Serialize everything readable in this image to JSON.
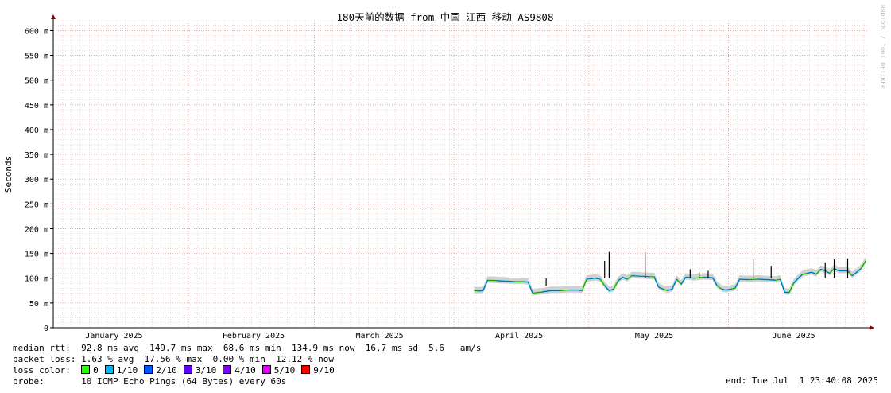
{
  "watermark": "RRDTOOL / TOBI OETIKER",
  "chart_data": {
    "type": "line",
    "title": "180天前的数据 from 中国 江西 移动 AS9808",
    "ylabel": "Seconds",
    "xlabel": "",
    "ylim": [
      0,
      0.62
    ],
    "y_ticks": [
      {
        "v": 0,
        "label": "0"
      },
      {
        "v": 0.05,
        "label": "50 m"
      },
      {
        "v": 0.1,
        "label": "100 m"
      },
      {
        "v": 0.15,
        "label": "150 m"
      },
      {
        "v": 0.2,
        "label": "200 m"
      },
      {
        "v": 0.25,
        "label": "250 m"
      },
      {
        "v": 0.3,
        "label": "300 m"
      },
      {
        "v": 0.35,
        "label": "350 m"
      },
      {
        "v": 0.4,
        "label": "400 m"
      },
      {
        "v": 0.45,
        "label": "450 m"
      },
      {
        "v": 0.5,
        "label": "500 m"
      },
      {
        "v": 0.55,
        "label": "550 m"
      },
      {
        "v": 0.6,
        "label": "600 m"
      }
    ],
    "x_labels": [
      {
        "label": "January 2025",
        "date": "2025-01-15"
      },
      {
        "label": "February 2025",
        "date": "2025-02-15"
      },
      {
        "label": "March 2025",
        "date": "2025-03-15"
      },
      {
        "label": "April 2025",
        "date": "2025-04-15"
      },
      {
        "label": "May 2025",
        "date": "2025-05-15"
      },
      {
        "label": "June 2025",
        "date": "2025-06-15"
      }
    ],
    "x_range": [
      "2025-01-02",
      "2025-07-01"
    ],
    "grid": true,
    "series": [
      {
        "name": "median rtt",
        "points": [
          [
            "2025-04-05",
            0.075
          ],
          [
            "2025-04-06",
            0.074
          ],
          [
            "2025-04-07",
            0.075
          ],
          [
            "2025-04-08",
            0.096
          ],
          [
            "2025-04-10",
            0.095
          ],
          [
            "2025-04-12",
            0.094
          ],
          [
            "2025-04-14",
            0.093
          ],
          [
            "2025-04-16",
            0.093
          ],
          [
            "2025-04-17",
            0.092
          ],
          [
            "2025-04-18",
            0.07
          ],
          [
            "2025-04-20",
            0.072
          ],
          [
            "2025-04-22",
            0.075
          ],
          [
            "2025-04-24",
            0.075
          ],
          [
            "2025-04-26",
            0.076
          ],
          [
            "2025-04-28",
            0.076
          ],
          [
            "2025-04-29",
            0.075
          ],
          [
            "2025-04-30",
            0.098
          ],
          [
            "2025-05-02",
            0.1
          ],
          [
            "2025-05-03",
            0.098
          ],
          [
            "2025-05-04",
            0.085
          ],
          [
            "2025-05-05",
            0.075
          ],
          [
            "2025-05-06",
            0.078
          ],
          [
            "2025-05-07",
            0.095
          ],
          [
            "2025-05-08",
            0.102
          ],
          [
            "2025-05-09",
            0.098
          ],
          [
            "2025-05-10",
            0.105
          ],
          [
            "2025-05-12",
            0.104
          ],
          [
            "2025-05-14",
            0.103
          ],
          [
            "2025-05-15",
            0.103
          ],
          [
            "2025-05-16",
            0.082
          ],
          [
            "2025-05-17",
            0.078
          ],
          [
            "2025-05-18",
            0.075
          ],
          [
            "2025-05-19",
            0.078
          ],
          [
            "2025-05-20",
            0.098
          ],
          [
            "2025-05-21",
            0.088
          ],
          [
            "2025-05-22",
            0.102
          ],
          [
            "2025-05-24",
            0.1
          ],
          [
            "2025-05-26",
            0.102
          ],
          [
            "2025-05-28",
            0.101
          ],
          [
            "2025-05-29",
            0.085
          ],
          [
            "2025-05-30",
            0.078
          ],
          [
            "2025-05-31",
            0.076
          ],
          [
            "2025-06-01",
            0.078
          ],
          [
            "2025-06-02",
            0.08
          ],
          [
            "2025-06-03",
            0.098
          ],
          [
            "2025-06-05",
            0.097
          ],
          [
            "2025-06-07",
            0.098
          ],
          [
            "2025-06-09",
            0.097
          ],
          [
            "2025-06-11",
            0.096
          ],
          [
            "2025-06-12",
            0.098
          ],
          [
            "2025-06-13",
            0.072
          ],
          [
            "2025-06-14",
            0.071
          ],
          [
            "2025-06-15",
            0.09
          ],
          [
            "2025-06-16",
            0.1
          ],
          [
            "2025-06-17",
            0.108
          ],
          [
            "2025-06-18",
            0.11
          ],
          [
            "2025-06-19",
            0.112
          ],
          [
            "2025-06-20",
            0.108
          ],
          [
            "2025-06-21",
            0.118
          ],
          [
            "2025-06-22",
            0.115
          ],
          [
            "2025-06-23",
            0.11
          ],
          [
            "2025-06-24",
            0.12
          ],
          [
            "2025-06-25",
            0.115
          ],
          [
            "2025-06-27",
            0.115
          ],
          [
            "2025-06-28",
            0.105
          ],
          [
            "2025-06-29",
            0.112
          ],
          [
            "2025-06-30",
            0.12
          ],
          [
            "2025-07-01",
            0.135
          ]
        ],
        "spikes": [
          [
            "2025-04-21",
            0.085
          ],
          [
            "2025-05-04",
            0.135
          ],
          [
            "2025-05-05",
            0.153
          ],
          [
            "2025-05-13",
            0.152
          ],
          [
            "2025-05-23",
            0.118
          ],
          [
            "2025-05-25",
            0.112
          ],
          [
            "2025-05-27",
            0.115
          ],
          [
            "2025-06-06",
            0.138
          ],
          [
            "2025-06-10",
            0.125
          ],
          [
            "2025-06-22",
            0.132
          ],
          [
            "2025-06-24",
            0.138
          ],
          [
            "2025-06-27",
            0.14
          ]
        ]
      }
    ],
    "loss_legend_label": "loss color:",
    "loss_colors": [
      {
        "label": "0",
        "color": "#26ff00"
      },
      {
        "label": "1/10",
        "color": "#00b8ff"
      },
      {
        "label": "2/10",
        "color": "#0059ff"
      },
      {
        "label": "3/10",
        "color": "#5e00ff"
      },
      {
        "label": "4/10",
        "color": "#7e00ff"
      },
      {
        "label": "5/10",
        "color": "#dd00ff"
      },
      {
        "label": "9/10",
        "color": "#ff0000"
      }
    ]
  },
  "stats": {
    "rtt_line": "median rtt:  92.8 ms avg  149.7 ms max  68.6 ms min  134.9 ms now  16.7 ms sd  5.6   am/s",
    "loss_line": "packet loss: 1.63 % avg  17.56 % max  0.00 % min  12.12 % now",
    "probe_line": "probe:       10 ICMP Echo Pings (64 Bytes) every 60s",
    "end_line": "end: Tue Jul  1 23:40:08 2025"
  }
}
